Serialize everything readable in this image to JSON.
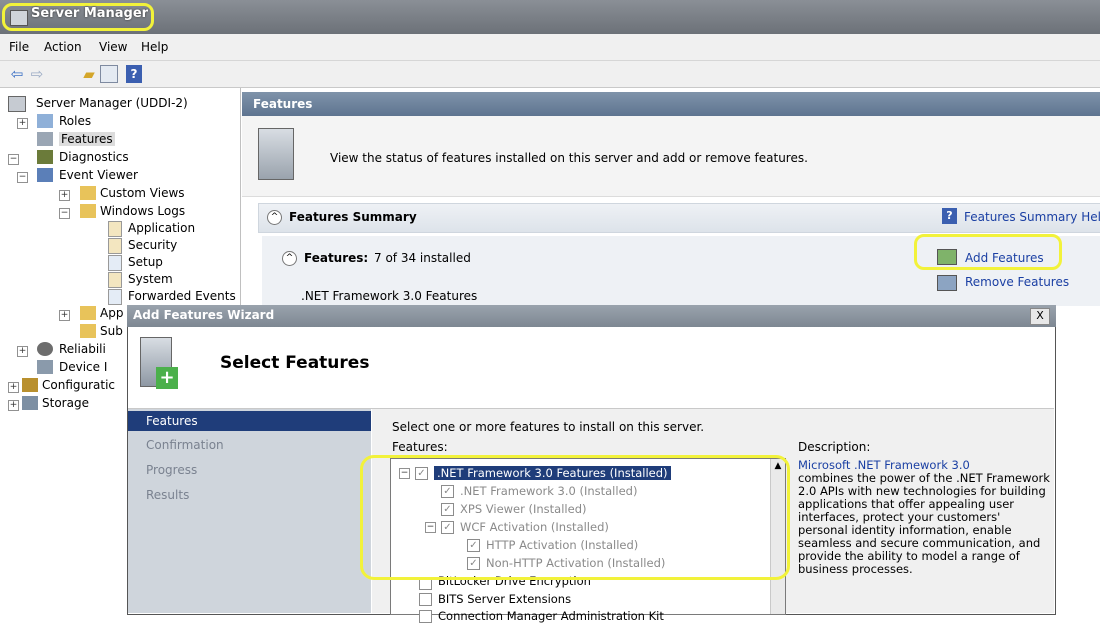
{
  "window": {
    "title": "Server Manager"
  },
  "menu": {
    "items": [
      "File",
      "Action",
      "View",
      "Help"
    ]
  },
  "toolbar": {
    "icons": [
      "back-arrow-icon",
      "forward-arrow-icon",
      "up-folder-icon",
      "show-hide-tree-icon",
      "help-icon"
    ]
  },
  "tree": {
    "root": "Server Manager (UDDI-2)",
    "roles": "Roles",
    "features": "Features",
    "diagnostics": "Diagnostics",
    "event_viewer": "Event Viewer",
    "custom_views": "Custom Views",
    "windows_logs": "Windows Logs",
    "application": "Application",
    "security": "Security",
    "setup": "Setup",
    "system": "System",
    "forwarded_events": "Forwarded Events",
    "app_partial": "App",
    "sub_partial": "Sub",
    "reliability_partial": "Reliabili",
    "device_partial": "Device I",
    "configuration_partial": "Configuratic",
    "storage": "Storage"
  },
  "right": {
    "header": "Features",
    "description": "View the status of features installed on this server and add or remove features.",
    "summary_title": "Features Summary",
    "summary_help": "Features Summary Help",
    "features_label": "Features:",
    "features_count": "7 of 34 installed",
    "add_features": "Add Features",
    "remove_features": "Remove Features",
    "first_feature": ".NET Framework 3.0 Features"
  },
  "dialog": {
    "title": "Add Features Wizard",
    "close": "X",
    "heading": "Select Features",
    "nav": [
      "Features",
      "Confirmation",
      "Progress",
      "Results"
    ],
    "instruction": "Select one or more features to install on this server.",
    "features_label": "Features:",
    "description_label": "Description:",
    "description_link": "Microsoft .NET Framework 3.0",
    "description_text": "combines the power of the .NET Framework 2.0 APIs with new technologies for building applications that offer appealing user interfaces, protect your customers' personal identity information, enable seamless and secure communication, and provide the ability to model a range of business processes.",
    "features": [
      ".NET Framework 3.0 Features  (Installed)",
      ".NET Framework 3.0  (Installed)",
      "XPS Viewer  (Installed)",
      "WCF Activation  (Installed)",
      "HTTP Activation  (Installed)",
      "Non-HTTP Activation  (Installed)",
      "BitLocker Drive Encryption",
      "BITS Server Extensions",
      "Connection Manager Administration Kit"
    ]
  },
  "colors": {
    "highlight": "#f2f23a",
    "selection": "#1f3d7a",
    "link": "#1a3fa3"
  }
}
